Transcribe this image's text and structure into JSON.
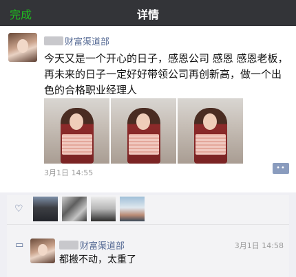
{
  "nav": {
    "back_label": "完成",
    "title": "详情"
  },
  "post": {
    "author": "财富渠道部",
    "text": "今天又是一个开心的日子，感恩公司 感恩 感恩老板，再未来的日子一定好好带领公司再创新高，做一个出色的合格职业经理人",
    "timestamp": "3月1日 14:55",
    "comment_icon": "two-dots-icon",
    "photos": [
      "photo-1",
      "photo-2",
      "photo-3"
    ]
  },
  "likes": {
    "icon": "heart-icon",
    "avatars": [
      "avatar-1",
      "avatar-2",
      "avatar-3",
      "avatar-4"
    ]
  },
  "comment": {
    "icon": "speech-bubble-icon",
    "author": "财富渠道部",
    "text": "都搬不动，太重了",
    "time": "3月1日 14:58"
  },
  "colors": {
    "nav_bg": "#333438",
    "accent_green": "#1fba1f",
    "link_blue": "#576b95"
  }
}
